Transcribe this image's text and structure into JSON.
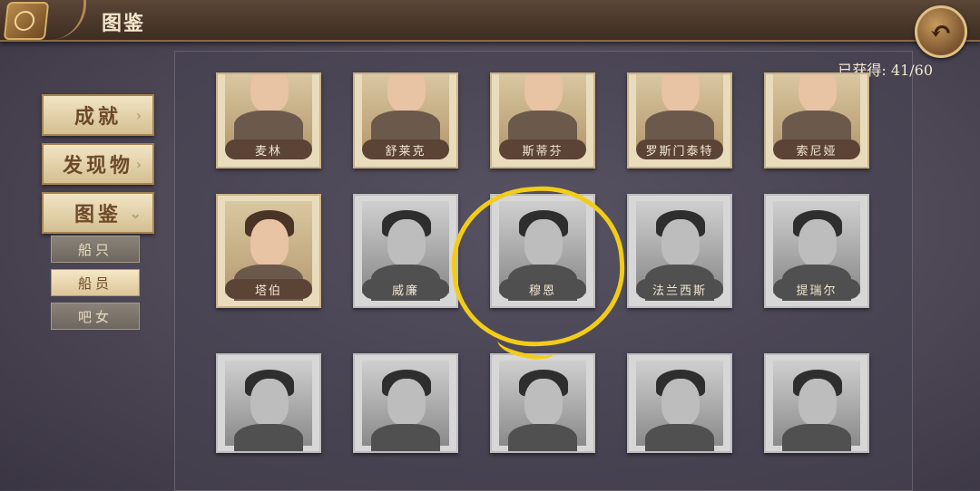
{
  "header": {
    "title": "图鉴"
  },
  "collection_count": "已获得: 41/60",
  "menu": {
    "main": [
      {
        "label": "成就",
        "chevron": "›"
      },
      {
        "label": "发现物",
        "chevron": "›"
      },
      {
        "label": "图鉴",
        "chevron": "⌄"
      }
    ],
    "sub": [
      {
        "label": "船只"
      },
      {
        "label": "船员"
      },
      {
        "label": "吧女"
      }
    ]
  },
  "cards": {
    "row1": [
      "麦林",
      "舒莱克",
      "斯蒂芬",
      "罗斯门泰特",
      "索尼娅"
    ],
    "row2": [
      "塔伯",
      "威廉",
      "穆恩",
      "法兰西斯",
      "提瑞尔"
    ]
  },
  "colors": {
    "highlight": "#f2cc19",
    "accent": "#c79a5d"
  }
}
